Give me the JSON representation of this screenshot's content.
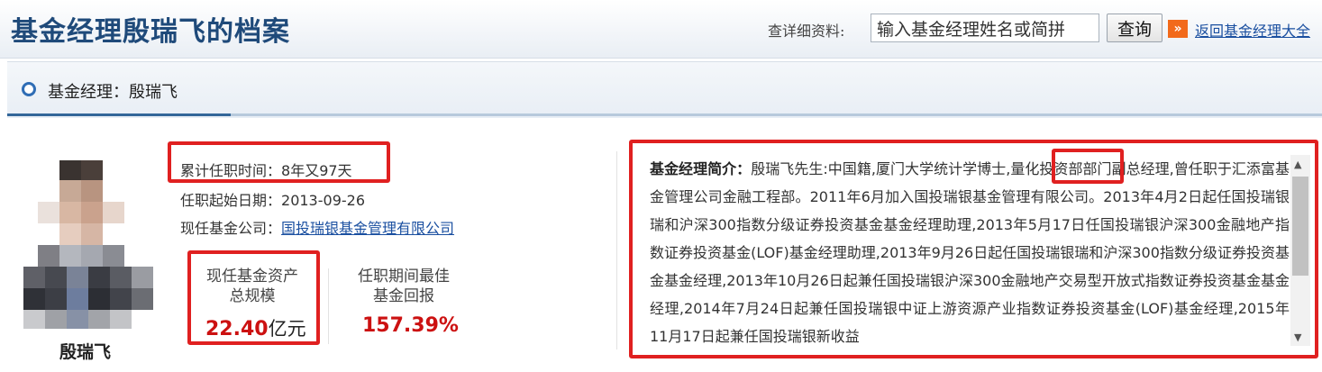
{
  "header": {
    "title": "基金经理殷瑞飞的档案",
    "search_label": "查详细资料:",
    "search_placeholder": "输入基金经理姓名或简拼",
    "search_button": "查询",
    "back_link": "返回基金经理大全"
  },
  "panel": {
    "title": "基金经理：殷瑞飞"
  },
  "manager": {
    "name": "殷瑞飞",
    "tenure_label": "累计任职时间：",
    "tenure_value": "8年又97天",
    "start_label": "任职起始日期：",
    "start_value": "2013-09-26",
    "company_label": "现任基金公司：",
    "company_value": "国投瑞银基金管理有限公司"
  },
  "stats": {
    "aum_label_line1": "现任基金资产",
    "aum_label_line2": "总规模",
    "aum_value": "22.40",
    "aum_unit": "亿元",
    "return_label_line1": "任职期间最佳",
    "return_label_line2": "基金回报",
    "return_value": "157.39%"
  },
  "bio": {
    "label": "基金经理简介：",
    "text": "殷瑞飞先生:中国籍,厦门大学统计学博士,量化投资部部门副总经理,曾任职于汇添富基金管理公司金融工程部。2011年6月加入国投瑞银基金管理有限公司。2013年4月2日起任国投瑞银瑞和沪深300指数分级证券投资基金基金经理助理,2013年5月17日任国投瑞银沪深300金融地产指数证券投资基金(LOF)基金经理助理,2013年9月26日起任国投瑞银瑞和沪深300指数分级证券投资基金基金经理,2013年10月26日起兼任国投瑞银沪深300金融地产交易型开放式指数证券投资基金基金经理,2014年7月24日起兼任国投瑞银中证上游资源产业指数证券投资基金(LOF)基金经理,2015年11月17日起兼任国投瑞银新收益"
  },
  "colors": {
    "accent": "#1f4a7a",
    "highlight_box": "#e02020",
    "value_red": "#cc1111"
  }
}
